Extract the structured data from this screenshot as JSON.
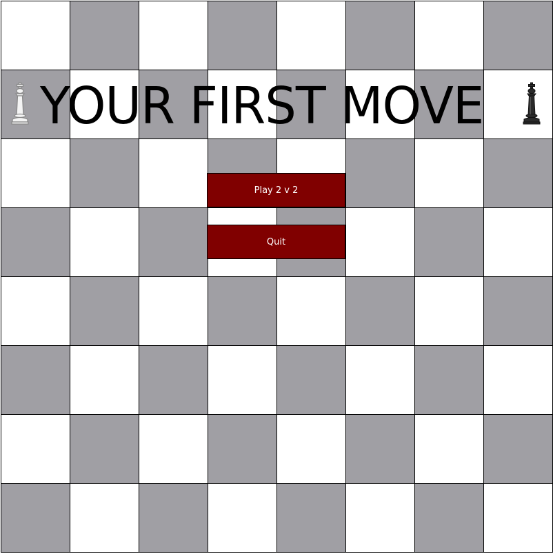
{
  "title": "YOUR FIRST MOVE",
  "menu": {
    "play_label": "Play 2 v 2",
    "quit_label": "Quit"
  },
  "decorations": {
    "left_piece": "white-king-icon",
    "right_piece": "black-king-icon"
  },
  "colors": {
    "light_square": "#ffffff",
    "dark_square": "#a09fa4",
    "button": "#800000",
    "button_text": "#ffffff",
    "title_text": "#000000"
  }
}
